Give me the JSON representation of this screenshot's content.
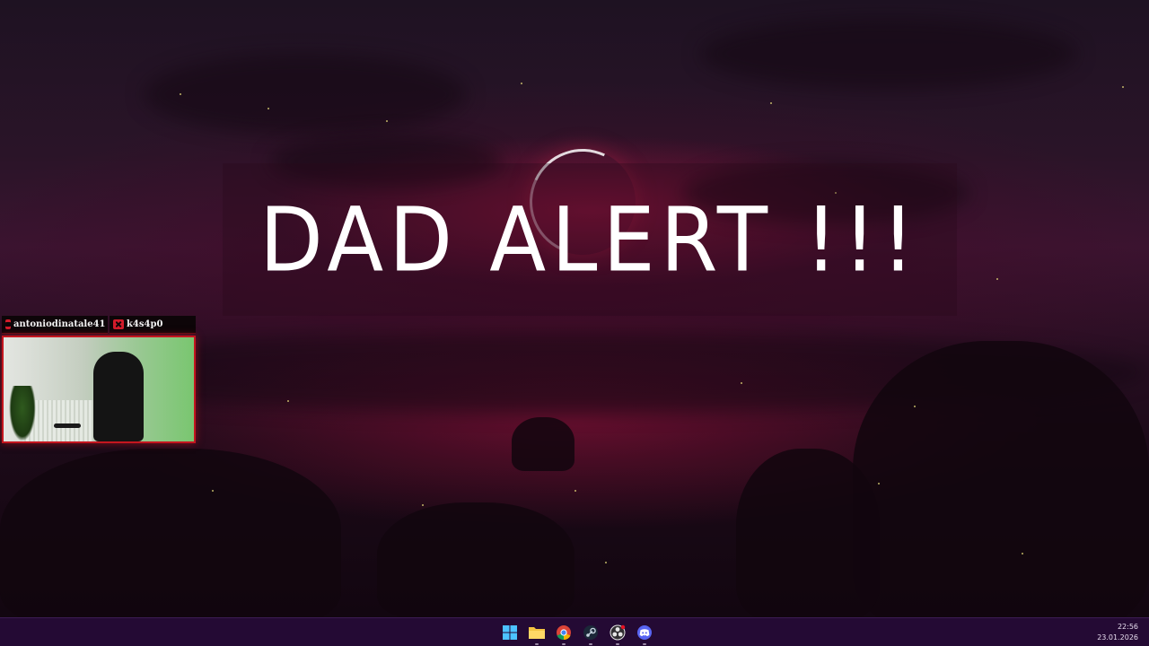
{
  "alert": {
    "text": "DAD ALERT !!!"
  },
  "webcam": {
    "tags": [
      {
        "name": "antoniodinatale41",
        "icon": "youtube-icon"
      },
      {
        "name": "k4s4p0",
        "icon": "x-icon"
      }
    ]
  },
  "taskbar": {
    "apps": [
      {
        "name": "Start",
        "icon": "windows-start-icon"
      },
      {
        "name": "File Explorer",
        "icon": "folder-icon"
      },
      {
        "name": "Chrome",
        "icon": "chrome-icon"
      },
      {
        "name": "Steam",
        "icon": "steam-icon"
      },
      {
        "name": "OBS Studio",
        "icon": "obs-icon"
      },
      {
        "name": "Discord",
        "icon": "discord-icon"
      }
    ],
    "time": "22:56",
    "date": "23.01.2026"
  },
  "colors": {
    "taskbar_bg": "#240a34",
    "cam_border": "#c4161f",
    "tag_badge": "#d21b2a",
    "alert_text": "#ffffff"
  }
}
